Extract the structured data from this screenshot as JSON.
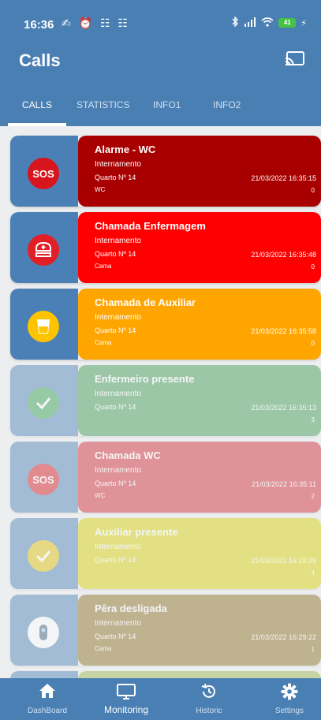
{
  "status_bar": {
    "time": "16:36",
    "left_icons": "✍ ⏰ ☷ ☷",
    "battery": "41"
  },
  "header": {
    "title": "Calls"
  },
  "tabs": [
    {
      "label": "CALLS"
    },
    {
      "label": "STATISTICS"
    },
    {
      "label": "INFO1"
    },
    {
      "label": "INFO2"
    }
  ],
  "calls": [
    {
      "title": "Alarme - WC",
      "department": "Internamento",
      "room": "Quarto Nº 14",
      "datetime": "21/03/2022 16:35:15",
      "location": "WC",
      "count": "0",
      "color": "#a80000",
      "icon": "sos-badge",
      "faded": false
    },
    {
      "title": "Chamada Enfermagem",
      "department": "Internamento",
      "room": "Quarto Nº 14",
      "datetime": "21/03/2022 16:35:48",
      "location": "Cama",
      "count": "0",
      "color": "#ff0000",
      "icon": "nurse-cap-badge",
      "faded": false
    },
    {
      "title": "Chamada de Auxiliar",
      "department": "Internamento",
      "room": "Quarto Nº 14",
      "datetime": "21/03/2022 16:35:58",
      "location": "Cama",
      "count": "0",
      "color": "#ffa500",
      "icon": "cup-badge",
      "faded": false
    },
    {
      "title": "Enfermeiro presente",
      "department": "Internamento",
      "room": "Quarto Nº 14",
      "datetime": "21/03/2022 16:35:13",
      "location": "",
      "count": "3",
      "color": "#3c9a4f",
      "icon": "check-badge-green",
      "faded": true
    },
    {
      "title": "Chamada WC",
      "department": "Internamento",
      "room": "Quarto Nº 14",
      "datetime": "21/03/2022 16:35:11",
      "location": "WC",
      "count": "2",
      "color": "#d0252e",
      "icon": "sos-badge",
      "faded": true
    },
    {
      "title": "Auxiliar presente",
      "department": "Internamento",
      "room": "Quarto Nº 14",
      "datetime": "21/03/2022 16:29:29",
      "location": "",
      "count": "4",
      "color": "#d6d100",
      "icon": "check-badge-yellow",
      "faded": true
    },
    {
      "title": "Pêra desligada",
      "department": "Internamento",
      "room": "Quarto Nº 14",
      "datetime": "21/03/2022 16:29:22",
      "location": "Cama",
      "count": "1",
      "color": "#8a6a1a",
      "icon": "device-badge",
      "faded": true
    }
  ],
  "bottom_nav": [
    {
      "label": "DashBoard",
      "icon": "home-icon"
    },
    {
      "label": "Monitoring",
      "icon": "monitor-icon"
    },
    {
      "label": "Historic",
      "icon": "history-icon"
    },
    {
      "label": "Settings",
      "icon": "gear-icon"
    }
  ],
  "colors": {
    "primary": "#4a7fb3",
    "card_left": "#4a80b6"
  }
}
